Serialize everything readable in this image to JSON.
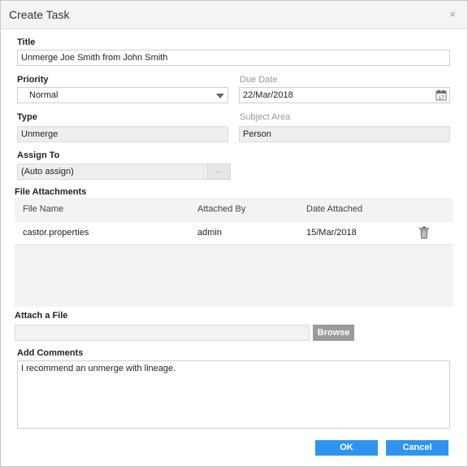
{
  "dialog": {
    "title": "Create Task",
    "close_glyph": "×"
  },
  "form": {
    "title_label": "Title",
    "title_value": "Unmerge Joe Smith from John Smith",
    "priority_label": "Priority",
    "priority_value": "Normal",
    "due_date_label": "Due Date",
    "due_date_value": "22/Mar/2018",
    "type_label": "Type",
    "type_value": "Unmerge",
    "subject_area_label": "Subject Area",
    "subject_area_value": "Person",
    "assign_to_label": "Assign To",
    "assign_to_value": "(Auto assign)",
    "assign_button_label": "..."
  },
  "attachments": {
    "section_label": "File Attachments",
    "columns": [
      "File Name",
      "Attached By",
      "Date Attached"
    ],
    "rows": [
      {
        "file_name": "castor.properties",
        "attached_by": "admin",
        "date_attached": "15/Mar/2018"
      }
    ]
  },
  "attach_file": {
    "label": "Attach a File",
    "value": "",
    "browse_label": "Browse"
  },
  "comments": {
    "label": "Add Comments",
    "value": "I recommend an unmerge with lineage."
  },
  "footer": {
    "ok_label": "OK",
    "cancel_label": "Cancel"
  },
  "icons": {
    "calendar": "calendar-icon",
    "trash": "trash-icon",
    "close": "close-icon",
    "dropdown": "chevron-down-icon"
  },
  "colors": {
    "primary_button": "#2f93f1",
    "browse_button": "#9a9a9a",
    "readonly_field": "#eeeeee",
    "grid_background": "#f3f3f3"
  }
}
